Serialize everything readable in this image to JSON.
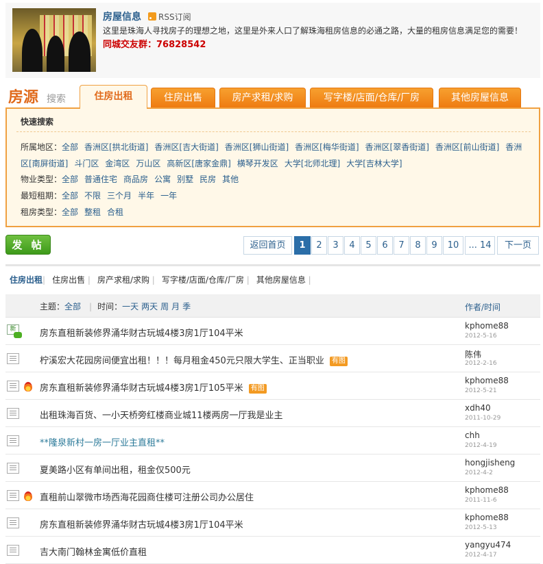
{
  "header": {
    "title": "房屋信息",
    "rss_label": "RSS订阅",
    "description": "这里是珠海人寻找房子的理想之地，这里是外来人口了解珠海租房信息的必通之路，大量的租房信息满足您的需要！",
    "qq_group": "同城交友群：76828542"
  },
  "category": {
    "brand": "房源",
    "brand_sub": "搜索",
    "tabs": [
      {
        "label": "住房出租"
      },
      {
        "label": "住房出售"
      },
      {
        "label": "房产求租/求购"
      },
      {
        "label": "写字楼/店面/仓库/厂房"
      },
      {
        "label": "其他房屋信息"
      }
    ]
  },
  "quick_search": {
    "title": "快速搜索",
    "area": {
      "label": "所属地区：",
      "options": [
        "全部",
        "香洲区[拱北街道]",
        "香洲区[吉大街道]",
        "香洲区[狮山街道]",
        "香洲区[梅华街道]",
        "香洲区[翠香街道]",
        "香洲区[前山街道]",
        "香洲区[南屏街道]",
        "斗门区",
        "金湾区",
        "万山区",
        "高新区[唐家金鼎]",
        "横琴开发区",
        "大学[北师北理]",
        "大学[吉林大学]"
      ]
    },
    "property_type": {
      "label": "物业类型：",
      "options": [
        "全部",
        "普通住宅",
        "商品房",
        "公寓",
        "别墅",
        "民房",
        "其他"
      ]
    },
    "lease_term": {
      "label": "最短租期：",
      "options": [
        "全部",
        "不限",
        "三个月",
        "半年",
        "一年"
      ]
    },
    "rent_type": {
      "label": "租房类型：",
      "options": [
        "全部",
        "整租",
        "合租"
      ]
    }
  },
  "post_button": "发 帖",
  "pagination": {
    "prev": "返回首页",
    "pages": [
      "1",
      "2",
      "3",
      "4",
      "5",
      "6",
      "7",
      "8",
      "9",
      "10",
      "... 14"
    ],
    "current": "1",
    "next": "下一页"
  },
  "subtabs": [
    "住房出租",
    "住房出售",
    "房产求租/求购",
    "写字楼/店面/仓库/厂房",
    "其他房屋信息"
  ],
  "list_header": {
    "topic_label": "主题：",
    "topic_all": "全部",
    "time_label": "时间：",
    "time_options": [
      "一天",
      "两天",
      "周",
      "月",
      "季"
    ],
    "author_col": "作者/时间"
  },
  "img_tag": "有图",
  "rows": [
    {
      "icon": "new",
      "fire": false,
      "subject": "房东直租新装修界涌华财古玩城4楼3房1厅104平米",
      "has_img": false,
      "link": false,
      "author": "kphome88",
      "date": "2012-5-16"
    },
    {
      "icon": "doc",
      "fire": false,
      "subject": "柠溪宏大花园房间便宜出租！！！每月租金450元只限大学生、正当职业",
      "has_img": true,
      "link": false,
      "author": "陈伟",
      "date": "2012-2-16"
    },
    {
      "icon": "doc",
      "fire": true,
      "subject": "房东直租新装修界涌华财古玩城4楼3房1厅105平米",
      "has_img": true,
      "link": false,
      "author": "kphome88",
      "date": "2012-5-21"
    },
    {
      "icon": "doc",
      "fire": false,
      "subject": "出租珠海百货、一小天桥旁红楼商业城11楼两房一厅我是业主",
      "has_img": false,
      "link": false,
      "author": "xdh40",
      "date": "2011-10-29"
    },
    {
      "icon": "doc",
      "fire": false,
      "subject": "**隆泉新村一房一厅业主直租**",
      "has_img": false,
      "link": true,
      "author": "chh",
      "date": "2012-4-19"
    },
    {
      "icon": "doc",
      "fire": false,
      "subject": "夏美路小区有单间出租，租金仅500元",
      "has_img": false,
      "link": false,
      "author": "hongjisheng",
      "date": "2012-4-2"
    },
    {
      "icon": "doc",
      "fire": true,
      "subject": "直租前山翠微市场西海花园商住楼可注册公司办公居住",
      "has_img": false,
      "link": false,
      "author": "kphome88",
      "date": "2011-11-6"
    },
    {
      "icon": "doc",
      "fire": false,
      "subject": "房东直租新装修界涌华财古玩城4楼3房1厅104平米",
      "has_img": false,
      "link": false,
      "author": "kphome88",
      "date": "2012-5-13"
    },
    {
      "icon": "doc",
      "fire": false,
      "subject": "吉大南门翰林金寓低价直租",
      "has_img": false,
      "link": false,
      "author": "yangyu474",
      "date": "2012-4-17"
    }
  ]
}
